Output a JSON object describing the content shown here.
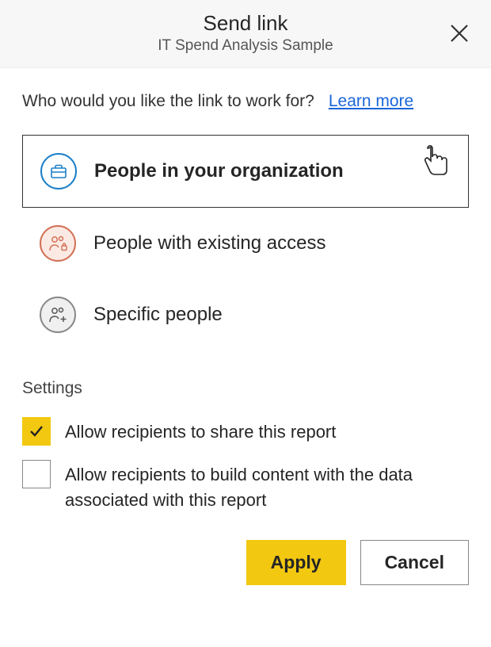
{
  "header": {
    "title": "Send link",
    "subtitle": "IT Spend Analysis Sample"
  },
  "prompt": {
    "question": "Who would you like the link to work for?",
    "learn_more": "Learn more"
  },
  "options": [
    {
      "label": "People in your organization",
      "icon": "briefcase",
      "selected": true
    },
    {
      "label": "People with existing access",
      "icon": "people-lock",
      "selected": false
    },
    {
      "label": "Specific people",
      "icon": "people-plus",
      "selected": false
    }
  ],
  "settings": {
    "heading": "Settings",
    "items": [
      {
        "label": "Allow recipients to share this report",
        "checked": true
      },
      {
        "label": "Allow recipients to build content with the data associated with this report",
        "checked": false
      }
    ]
  },
  "actions": {
    "apply": "Apply",
    "cancel": "Cancel"
  }
}
